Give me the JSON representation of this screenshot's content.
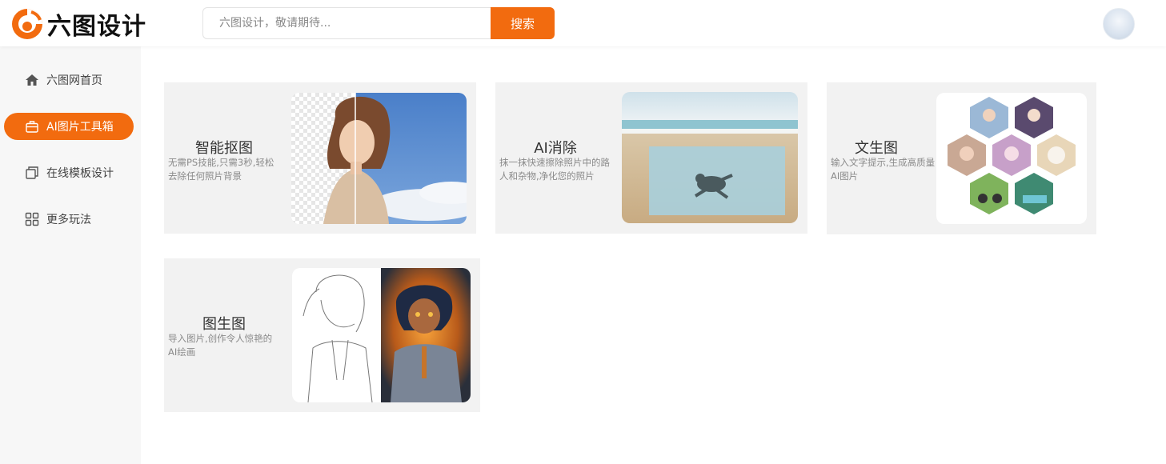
{
  "brand": {
    "name": "六图设计",
    "accent": "#f26b0f"
  },
  "search": {
    "placeholder": "六图设计，敬请期待...",
    "button_label": "搜索"
  },
  "sidebar": {
    "items": [
      {
        "label": "六图网首页",
        "icon": "home-icon",
        "active": false
      },
      {
        "label": "AI图片工具箱",
        "icon": "toolbox-icon",
        "active": true
      },
      {
        "label": "在线模板设计",
        "icon": "template-icon",
        "active": false
      },
      {
        "label": "更多玩法",
        "icon": "grid-icon",
        "active": false
      }
    ]
  },
  "cards": [
    {
      "title": "智能抠图",
      "desc": "无需PS技能,只需3秒,轻松去除任何照片背景"
    },
    {
      "title": "AI消除",
      "desc": "抹一抹快速擦除照片中的路人和杂物,净化您的照片"
    },
    {
      "title": "文生图",
      "desc": "输入文字提示,生成高质量AI图片"
    },
    {
      "title": "图生图",
      "desc": "导入图片,创作令人惊艳的AI绘画"
    }
  ]
}
